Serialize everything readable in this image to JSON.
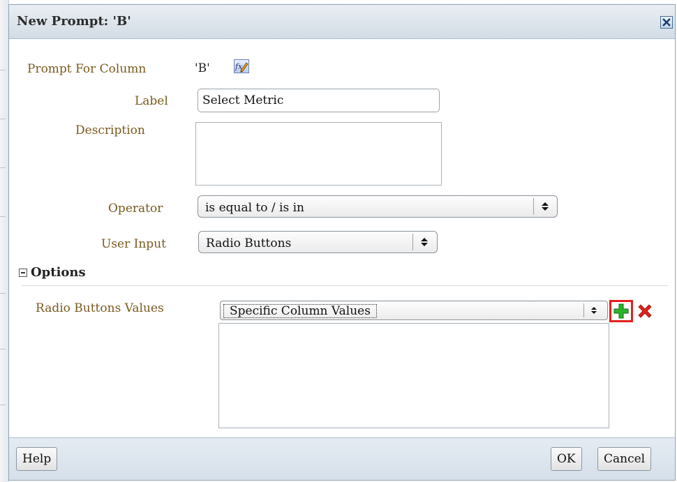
{
  "dialog": {
    "title": "New Prompt: 'B'"
  },
  "form": {
    "prompt_for_column_label": "Prompt For Column",
    "prompt_for_column_value": "'B'",
    "label_label": "Label",
    "label_value": "Select Metric",
    "description_label": "Description",
    "description_value": "",
    "operator_label": "Operator",
    "operator_value": "is equal to / is in",
    "user_input_label": "User Input",
    "user_input_value": "Radio Buttons"
  },
  "options": {
    "title": "Options",
    "radio_values_label": "Radio Buttons Values",
    "radio_values_select": "Specific Column Values"
  },
  "footer": {
    "help": "Help",
    "ok": "OK",
    "cancel": "Cancel"
  },
  "colors": {
    "label_text": "#7a5a1e",
    "titlebar": "#d3dce5",
    "highlight_border": "#e41e1e",
    "add_icon": "#2bb42b",
    "delete_icon": "#e2231a"
  },
  "icons": {
    "close": "close-icon",
    "edit_formula": "edit-formula-icon",
    "add": "add-icon",
    "delete": "delete-icon",
    "collapse": "collapse-icon"
  }
}
